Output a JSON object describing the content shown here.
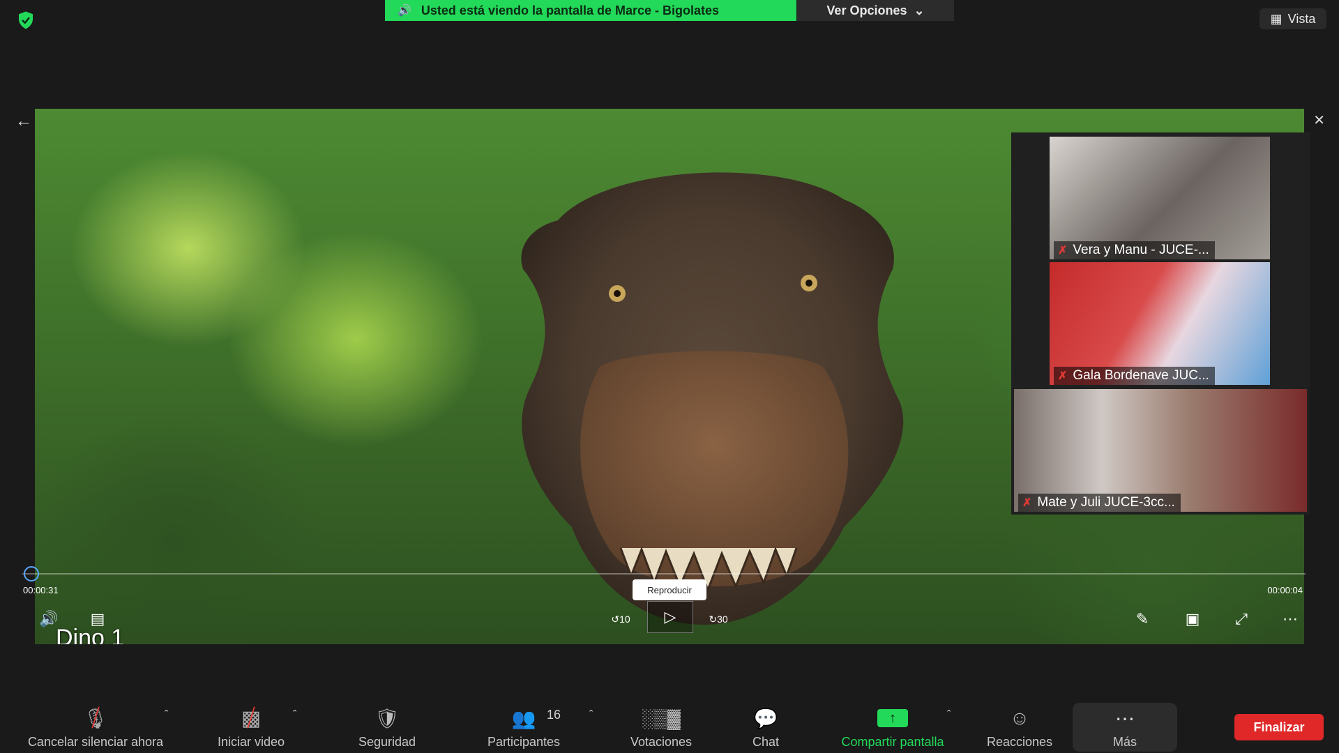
{
  "top_bar": {
    "share_banner": "Usted está viendo la pantalla de Marce - Bigolates",
    "view_options": "Ver Opciones",
    "vista": "Vista"
  },
  "video": {
    "title": "Dino 1",
    "time_elapsed": "00:00:31",
    "time_remaining": "00:00:04",
    "tooltip": "Reproducir",
    "rewind_label": "10",
    "forward_label": "30"
  },
  "participants": [
    {
      "name": "Vera y Manu - JUCE-...",
      "muted": true
    },
    {
      "name": "Gala Bordenave JUC...",
      "muted": true
    },
    {
      "name": "Mate y Juli JUCE-3cc...",
      "muted": true
    }
  ],
  "toolbar": {
    "mute": "Cancelar silenciar ahora",
    "video": "Iniciar video",
    "security": "Seguridad",
    "participants": "Participantes",
    "participants_count": "16",
    "polls": "Votaciones",
    "chat": "Chat",
    "share": "Compartir pantalla",
    "reactions": "Reacciones",
    "more": "Más",
    "end": "Finalizar"
  },
  "colors": {
    "share_green": "#23d959",
    "end_red": "#e02828",
    "background": "#1a1a1a"
  }
}
